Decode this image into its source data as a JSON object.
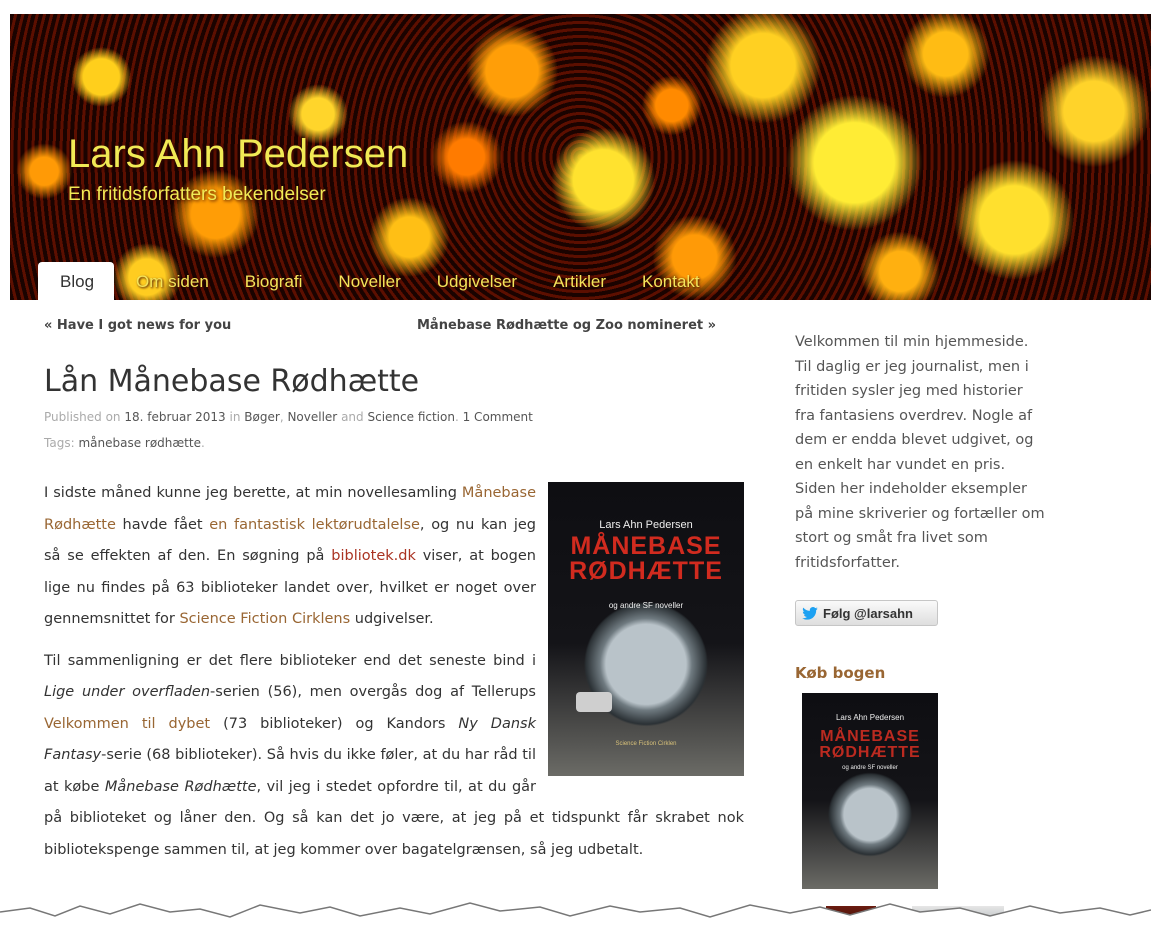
{
  "header": {
    "site_title": "Lars Ahn Pedersen",
    "site_description": "En fritidsforfatters bekendelser"
  },
  "nav": {
    "items": [
      {
        "label": "Blog",
        "active": true
      },
      {
        "label": "Om siden"
      },
      {
        "label": "Biografi"
      },
      {
        "label": "Noveller"
      },
      {
        "label": "Udgivelser"
      },
      {
        "label": "Artikler"
      },
      {
        "label": "Kontakt"
      }
    ]
  },
  "post_nav": {
    "prev": "« Have I got news for you",
    "next": "Månebase Rødhætte og Zoo nomineret »"
  },
  "post": {
    "title": "Lån Månebase Rødhætte",
    "meta_published": "Published on",
    "meta_date": "18. februar 2013",
    "meta_in": "in",
    "cat_1": "Bøger",
    "cat_2": "Noveller",
    "meta_and": "and",
    "cat_3": "Science fiction",
    "comments": "1 Comment",
    "tags_label": "Tags:",
    "tag_1": "månebase rødhætte",
    "p1_a": "I sidste måned kunne jeg berette, at min novellesamling ",
    "p1_link1": "Månebase Rødhætte",
    "p1_b": " havde fået ",
    "p1_link2": "en fantastisk lektørudtalelse",
    "p1_c": ", og nu kan jeg så se effekten af den. En søgning på ",
    "p1_link3": "bibliotek.dk",
    "p1_d": " viser, at bogen lige nu findes på 63 biblioteker landet over, hvilket er noget over gennemsnittet for ",
    "p1_link4": "Science Fiction Cirklens",
    "p1_e": " udgivelser.",
    "p2_a": "Til sammenligning er det flere biblioteker end det seneste bind i ",
    "p2_em1": "Lige under overfladen",
    "p2_b": "-serien (56), men overgås dog af Tellerups ",
    "p2_link1": "Velkommen til dybet",
    "p2_c": " (73 biblioteker) og Kandors ",
    "p2_em2": "Ny Dansk Fantasy",
    "p2_d": "-serie (68 biblioteker). Så hvis du ikke føler, at du har råd til at købe ",
    "p2_em3": "Månebase Rødhætte",
    "p2_e": ", vil jeg i stedet opfordre til, at du går på biblioteket og låner den. Og så kan det jo være, at jeg på et tidspunkt får skrabet nok bibliotekspenge sammen til, at jeg kommer over bagatelgrænsen, så jeg ",
    "p2_f": "udbetalt."
  },
  "book_cover": {
    "author": "Lars Ahn Pedersen",
    "title_line1": "MÅNEBASE",
    "title_line2": "RØDHÆTTE",
    "subtitle": "og andre SF noveller",
    "publisher": "Science Fiction Cirklen"
  },
  "sidebar": {
    "welcome": "Velkommen til min hjemmeside. Til daglig er jeg journalist, men i fritiden sysler jeg med historier fra fantasiens overdrev. Nogle af dem er endda blevet udgivet, og en enkelt har vundet en pris. Siden her indeholder eksempler på mine skriverier og fortæller om stort og småt fra livet som fritidsforfatter.",
    "follow_label": "Følg @larsahn",
    "buy_heading": "Køb bogen"
  },
  "colors": {
    "accent_link": "#996633",
    "title_yellow": "#f1ea55",
    "twitter_blue": "#1da1f2"
  }
}
